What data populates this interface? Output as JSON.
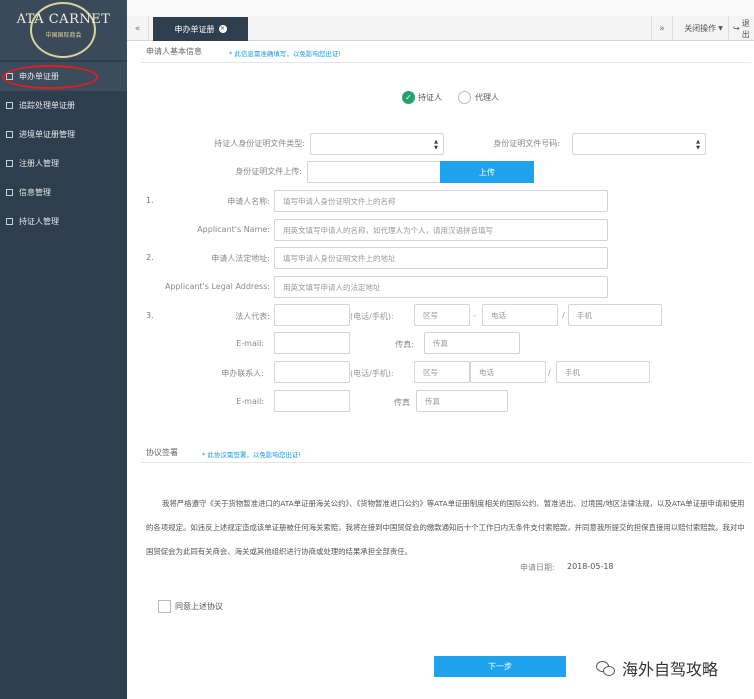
{
  "sidebar": {
    "logo_text": "ATA CARNET",
    "logo_sub": "中国国际商会",
    "items": [
      {
        "label": "申办单证册",
        "icon": "square-icon"
      },
      {
        "label": "追踪处理单证册",
        "icon": "square-icon"
      },
      {
        "label": "进境单证册管理",
        "icon": "square-icon"
      },
      {
        "label": "注册人管理",
        "icon": "square-icon"
      },
      {
        "label": "信息管理",
        "icon": "square-icon"
      },
      {
        "label": "持证人管理",
        "icon": "square-icon"
      }
    ]
  },
  "topbar": {
    "tab_label": "申办单证册",
    "close_all": "关闭操作",
    "logout": "退出"
  },
  "applicant": {
    "section_title": "申请人基本信息",
    "note": "* 此信息需准确填写，以免影响您出证!",
    "radio_holder": "持证人",
    "radio_agent": "代理人",
    "id_type_label": "持证人身份证明文件类型:",
    "id_number_label": "身份证明文件号码:",
    "upload_label": "身份证明文件上传:",
    "upload_button": "上传",
    "num1": "1.",
    "name_label": "申请人名称:",
    "name_placeholder": "填写申请人身份证明文件上的名称",
    "en_name_label": "Applicant's Name:",
    "en_name_placeholder": "用英文填写申请人的名称，如代理人为个人，请用汉语拼音填写",
    "num2": "2.",
    "address_label": "申请人法定地址:",
    "address_placeholder": "填写申请人身份证明文件上的地址",
    "en_address_label": "Applicant's Legal Address:",
    "en_address_placeholder": "用英文填写申请人的法定地址",
    "num3": "3.",
    "legal_rep_label": "法人代表:",
    "phone_mobile_1": "(电话/手机):",
    "area_code_1": "区号",
    "dash": "-",
    "phone_1": "电话",
    "slash_1": "/",
    "mobile_1": "手机",
    "email_label_1": "E-mail:",
    "fax_label_1": "传真:",
    "fax_1": "传真",
    "contact_label": "申办联系人:",
    "phone_mobile_2": "(电话/手机):",
    "area_code_2": "区号",
    "phone_2": "电话",
    "slash_2": "/",
    "mobile_2": "手机",
    "email_label_2": "E-mail:",
    "fax_label_2": "传真",
    "fax_2": "传真"
  },
  "agreement": {
    "section_title": "协议签署",
    "note": "* 此协议需签署，以免影响您出证!",
    "text": "我将严格遵守《关于货物暂准进口的ATA单证册海关公约》、《货物暂准进口公约》等ATA单证册制度相关的国际公约、暂准进出、过境国/地区法律法规，以及ATA单证册申请和使用的各项规定。如违反上述规定造成该单证册被任何海关索赔，我将在接到中国贸促会的缴款通知后十个工作日内无条件支付索赔款，并同意我所提交的担保直接用以赔付索赔款。我对中国贸促会为此同有关商会、海关或其他组织进行协商或处理的结果承担全部责任。",
    "date_label": "申请日期:",
    "date_value": "2018-05-18",
    "agree_label": "同意上述协议",
    "next_button": "下一步"
  },
  "watermark": {
    "text": "海外自驾攻略"
  }
}
